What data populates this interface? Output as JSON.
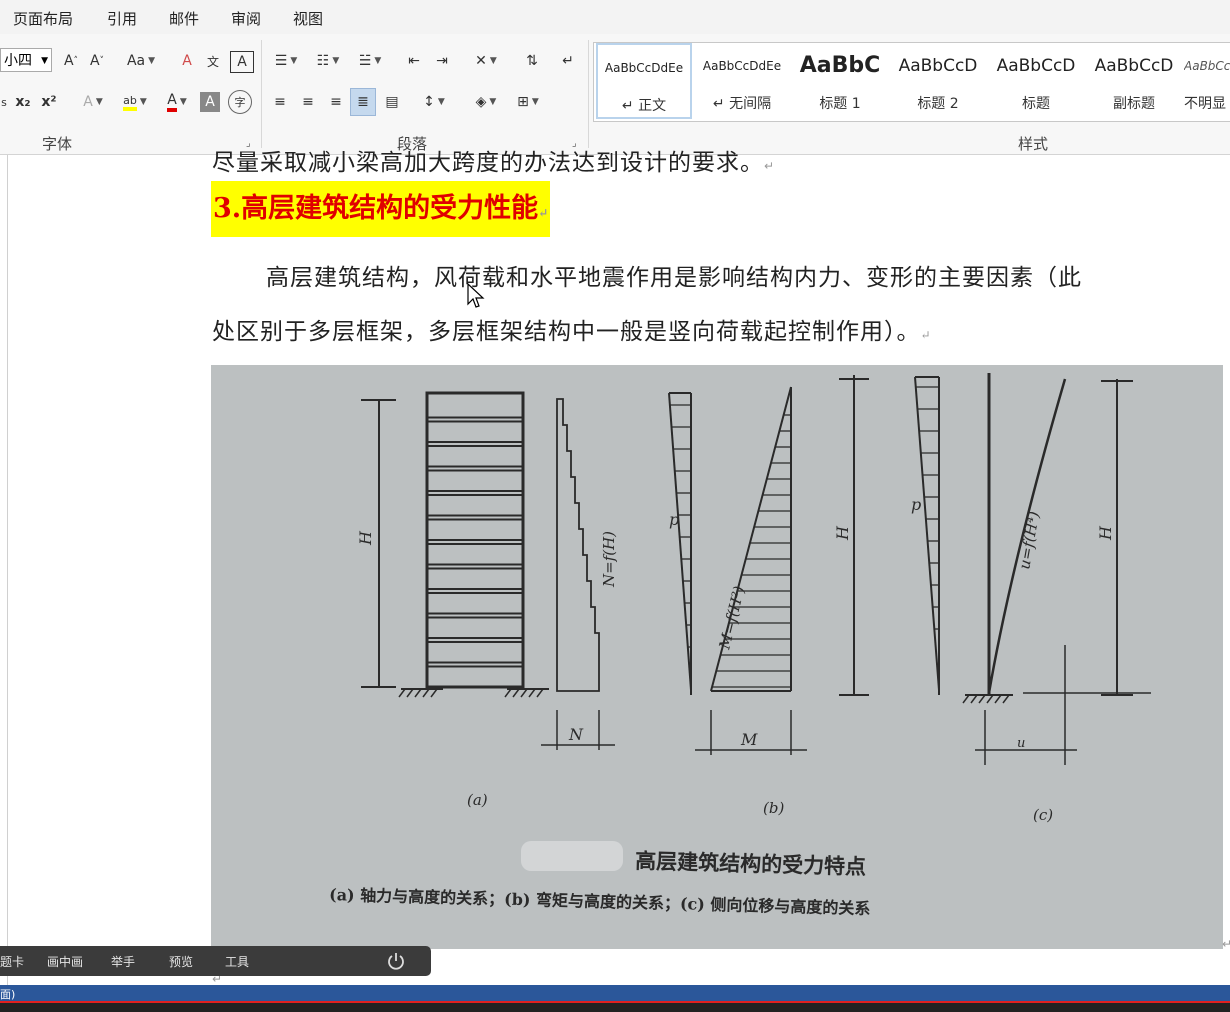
{
  "menu": [
    "页面布局",
    "引用",
    "邮件",
    "审阅",
    "视图"
  ],
  "ribbon": {
    "font_size": "小四",
    "groups": {
      "font": "字体",
      "paragraph": "段落",
      "styles": "样式"
    },
    "format_labels": {
      "change_case": "Aa",
      "clear_format": "A",
      "phonetic": "文",
      "char_border": "A",
      "subscript": "x₂",
      "superscript": "x²",
      "text_effect": "A",
      "highlight": "ab",
      "font_color": "A",
      "char_shading": "A",
      "enclose": "字"
    },
    "styles": [
      {
        "preview": "AaBbCcDdEe",
        "name": "↵ 正文"
      },
      {
        "preview": "AaBbCcDdEe",
        "name": "↵ 无间隔"
      },
      {
        "preview": "AaBbC",
        "name": "标题 1"
      },
      {
        "preview": "AaBbCcD",
        "name": "标题 2"
      },
      {
        "preview": "AaBbCcD",
        "name": "标题"
      },
      {
        "preview": "AaBbCcD",
        "name": "副标题"
      },
      {
        "preview": "AaBbCcD",
        "name": "不明显"
      }
    ]
  },
  "document": {
    "cut_line": "尽量采取减小梁高加大跨度的办法达到设计的要求。",
    "heading": "3.高层建筑结构的受力性能",
    "para_line1": "高层建筑结构，风荷载和水平地震作用是影响结构内力、变形的主要因素（此",
    "para_line2": "处区别于多层框架，多层框架结构中一般是竖向荷载起控制作用）。",
    "mark": "↵"
  },
  "figure": {
    "label_H": "H",
    "label_p": "p",
    "label_N_eq": "N=f(H)",
    "label_M_eq": "M=f(H²)",
    "label_u_eq": "u=f(H⁴)",
    "label_N": "N",
    "label_M": "M",
    "label_u": "u",
    "sub_a": "(a)",
    "sub_b": "(b)",
    "sub_c": "(c)",
    "caption_title": "高层建筑结构的受力特点",
    "caption_desc": "(a) 轴力与高度的关系；(b) 弯矩与高度的关系；(c) 侧向位移与高度的关系"
  },
  "taskbar": [
    "答题卡",
    "画中画",
    "举手",
    "预览",
    "工具"
  ],
  "status_text": "面)"
}
